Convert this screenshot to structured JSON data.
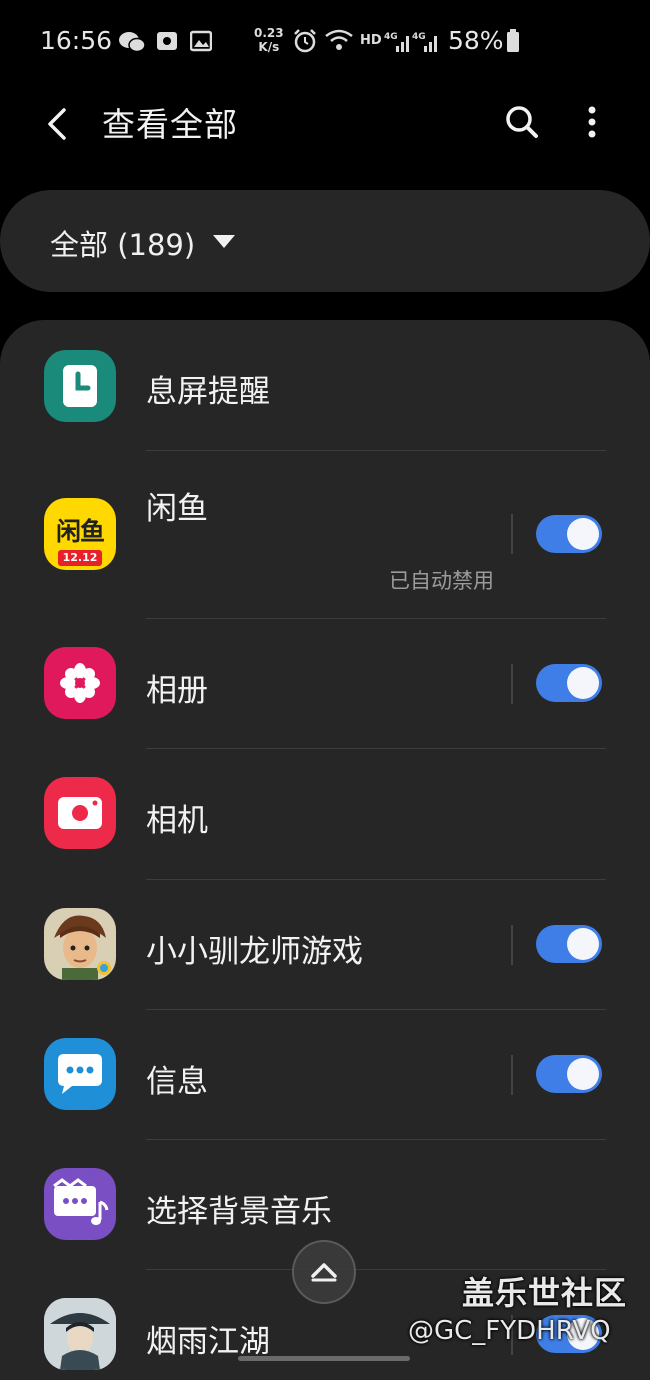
{
  "status_bar": {
    "time": "16:56",
    "speed_value": "0.23",
    "speed_unit": "K/s",
    "network": "HD",
    "battery": "58%",
    "icons": [
      "wechat-icon",
      "camera-notif-icon",
      "gallery-notif-icon",
      "alarm-icon",
      "wifi-icon",
      "signal-4g-icon",
      "signal-4g-icon",
      "battery-icon"
    ]
  },
  "app_bar": {
    "title": "查看全部",
    "back_icon": "back-arrow-icon",
    "search_icon": "search-icon",
    "more_icon": "more-vert-icon"
  },
  "filter": {
    "label": "全部 (189)"
  },
  "apps": [
    {
      "name": "息屏提醒",
      "icon": "always-on-display-clock-icon",
      "color": "#1a8a7a",
      "toggle": null,
      "subtitle": ""
    },
    {
      "name": "闲鱼",
      "icon": "xianyu-icon",
      "color": "#ffd800",
      "toggle": true,
      "subtitle": "已自动禁用"
    },
    {
      "name": "相册",
      "icon": "gallery-flower-icon",
      "color": "#e0195c",
      "toggle": true,
      "subtitle": ""
    },
    {
      "name": "相机",
      "icon": "camera-icon",
      "color": "#ee2a4a",
      "toggle": null,
      "subtitle": ""
    },
    {
      "name": "小小驯龙师游戏",
      "icon": "dragon-trainer-game-icon",
      "color": "#6a5a3a",
      "toggle": true,
      "subtitle": ""
    },
    {
      "name": "信息",
      "icon": "messages-icon",
      "color": "#1f90d8",
      "toggle": true,
      "subtitle": ""
    },
    {
      "name": "选择背景音乐",
      "icon": "background-music-icon",
      "color": "#7b4fc4",
      "toggle": null,
      "subtitle": ""
    },
    {
      "name": "烟雨江湖",
      "icon": "yanyu-jianghu-game-icon",
      "color": "#c9d2d6",
      "toggle": true,
      "subtitle": ""
    }
  ],
  "xianyu_badge": "12.12",
  "xianyu_logo": "闲鱼",
  "watermark": {
    "line1": "盖乐世社区",
    "line2": "@GC_FYDHRVQ"
  },
  "accent_color": "#3e7ee6"
}
